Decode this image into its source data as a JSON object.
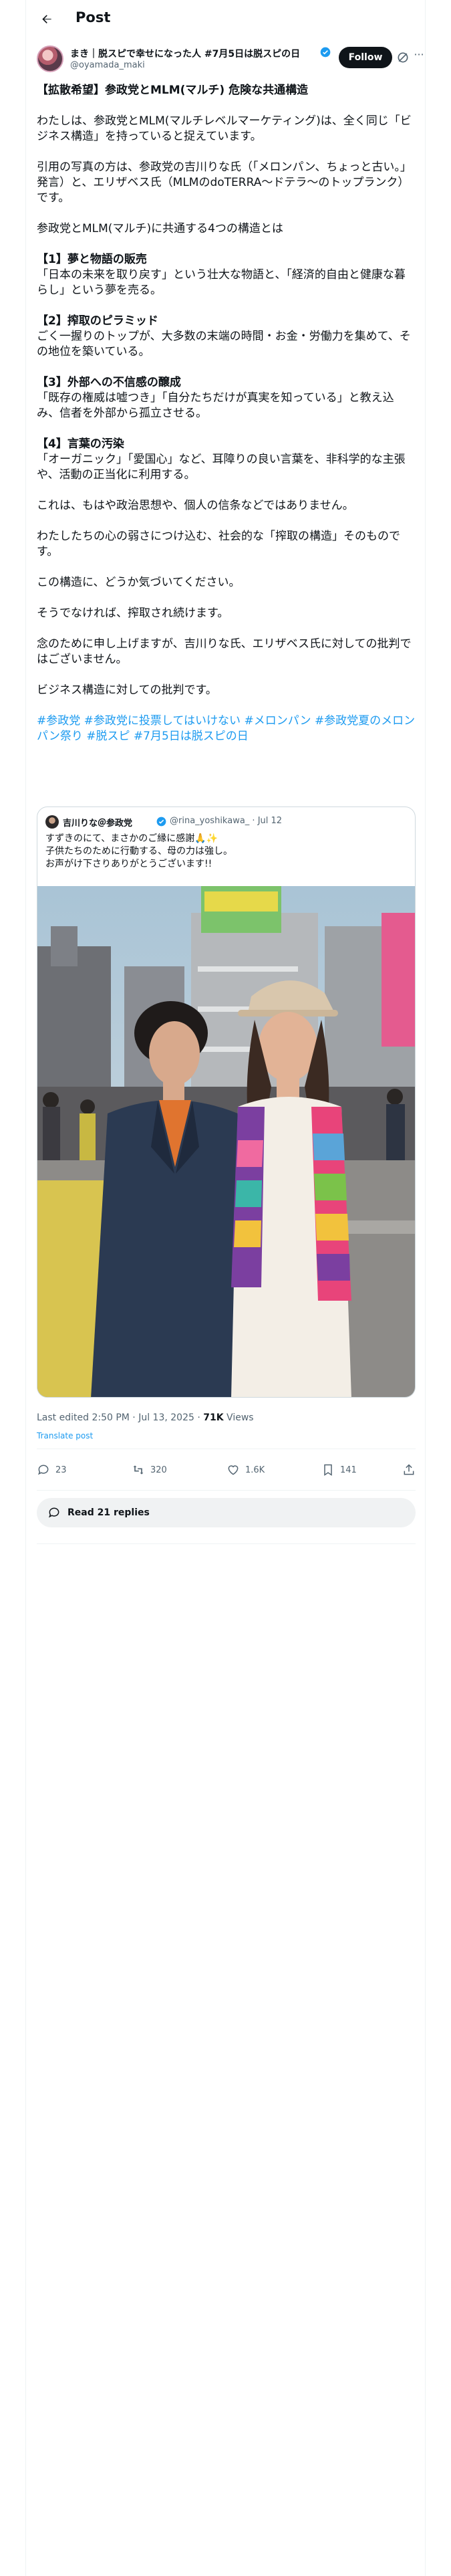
{
  "header": {
    "title": "Post"
  },
  "author": {
    "name": "まき｜脱スピで幸せになった人 #7月5日は脱スピの日",
    "handle": "@oyamada_maki",
    "follow_label": "Follow",
    "more_label": "···"
  },
  "post": {
    "title": "【拡散希望】参政党とMLM(マルチ) 危険な共通構造",
    "intro": "わたしは、参政党とMLM(マルチレベルマーケティング)は、全く同じ「ビジネス構造」を持っていると捉えています。",
    "photo_note": "引用の写真の方は、参政党の吉川りな氏（「メロンパン、ちょっと古い。」発言）と、エリザベス氏（MLMのdoTERRA～ドテラ～のトップランク）です。",
    "lead": "参政党とMLM(マルチ)に共通する4つの構造とは",
    "points": [
      {
        "heading": "【1】夢と物語の販売",
        "text": "「日本の未来を取り戻す」という壮大な物語と、「経済的自由と健康な暮らし」という夢を売る。"
      },
      {
        "heading": "【2】搾取のピラミッド",
        "text": "ごく一握りのトップが、大多数の末端の時間・お金・労働力を集めて、その地位を築いている。"
      },
      {
        "heading": "【3】外部への不信感の醸成",
        "text": "「既存の権威は嘘つき」「自分たちだけが真実を知っている」と教え込み、信者を外部から孤立させる。"
      },
      {
        "heading": "【4】言葉の汚染",
        "text": "「オーガニック」「愛国心」など、耳障りの良い言葉を、非科学的な主張や、活動の正当化に利用する。"
      }
    ],
    "closing": [
      "これは、もはや政治思想や、個人の信条などではありません。",
      "わたしたちの心の弱さにつけ込む、社会的な「搾取の構造」そのものです。",
      "この構造に、どうか気づいてください。",
      "そうでなければ、搾取され続けます。",
      "念のために申し上げますが、吉川りな氏、エリザベス氏に対しての批判ではございません。",
      "ビジネス構造に対しての批判です。"
    ],
    "hashtags": "#参政党 #参政党に投票してはいけない #メロンパン #参政党夏のメロンパン祭り #脱スピ #7月5日は脱スピの日"
  },
  "quote": {
    "name": "吉川りな＠参政党",
    "handle": "@rina_yoshikawa_ · Jul 12",
    "text": "すずきのにて、まさかのご縁に感謝🙏✨\n子供たちのために行動する、母の力は強し。\nお声がけ下さりありがとうございます!!"
  },
  "meta": {
    "edited": "Last edited 2:50 PM · Jul 13, 2025 · ",
    "views_count": "71K",
    "views_label": " Views",
    "translate": "Translate post"
  },
  "actions": {
    "replies": "23",
    "reposts": "320",
    "likes": "1.6K",
    "bookmarks": "141"
  },
  "read_replies": "Read 21 replies"
}
